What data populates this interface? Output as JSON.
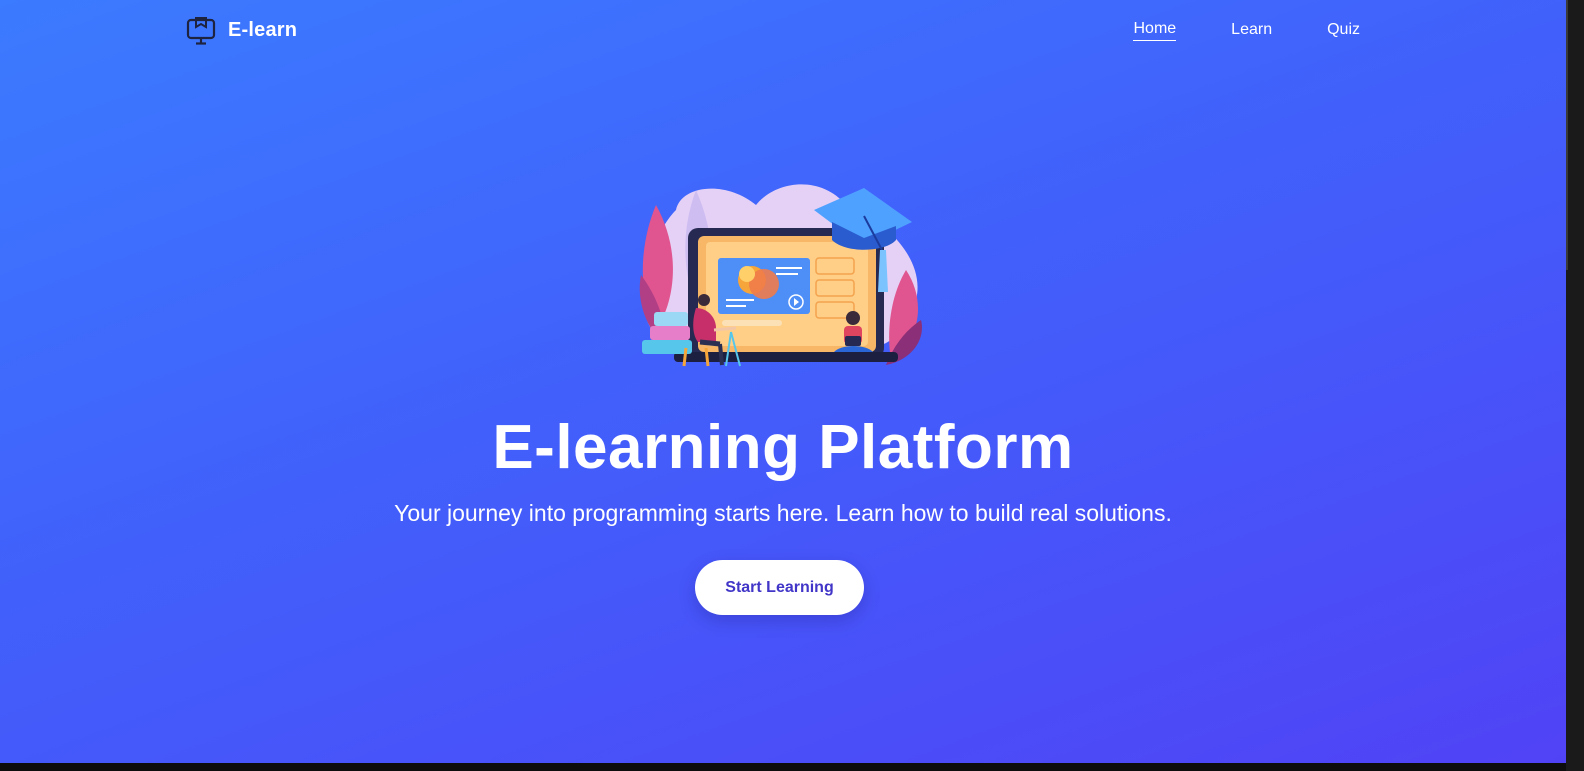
{
  "brand": {
    "name": "E-learn",
    "icon": "monitor-book-icon"
  },
  "nav": {
    "items": [
      {
        "label": "Home",
        "active": true
      },
      {
        "label": "Learn",
        "active": false
      },
      {
        "label": "Quiz",
        "active": false
      }
    ]
  },
  "hero": {
    "illustration": "e-learning-laptop-illustration",
    "title": "E-learning Platform",
    "subtitle": "Your journey into programming starts here. Learn how to build real solutions.",
    "cta_label": "Start Learning"
  },
  "colors": {
    "gradient_start": "#3b7bff",
    "gradient_end": "#5043f6",
    "cta_text": "#4136c8"
  }
}
